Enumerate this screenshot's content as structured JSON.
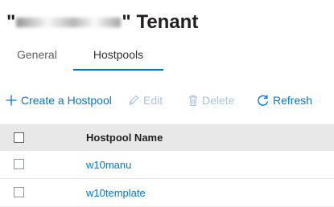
{
  "header": {
    "title_prefix": "\"",
    "title_suffix": "\" Tenant"
  },
  "tabs": [
    {
      "label": "General",
      "selected": false
    },
    {
      "label": "Hostpools",
      "selected": true
    }
  ],
  "toolbar": {
    "create_label": "Create a Hostpool",
    "edit_label": "Edit",
    "delete_label": "Delete",
    "refresh_label": "Refresh"
  },
  "table": {
    "columns": [
      "Hostpool Name"
    ],
    "rows": [
      {
        "name": "w10manu"
      },
      {
        "name": "w10template"
      }
    ]
  },
  "colors": {
    "accent": "#0078d4",
    "disabled": "#a6c5e6",
    "header_bg": "#e8e8e8"
  }
}
